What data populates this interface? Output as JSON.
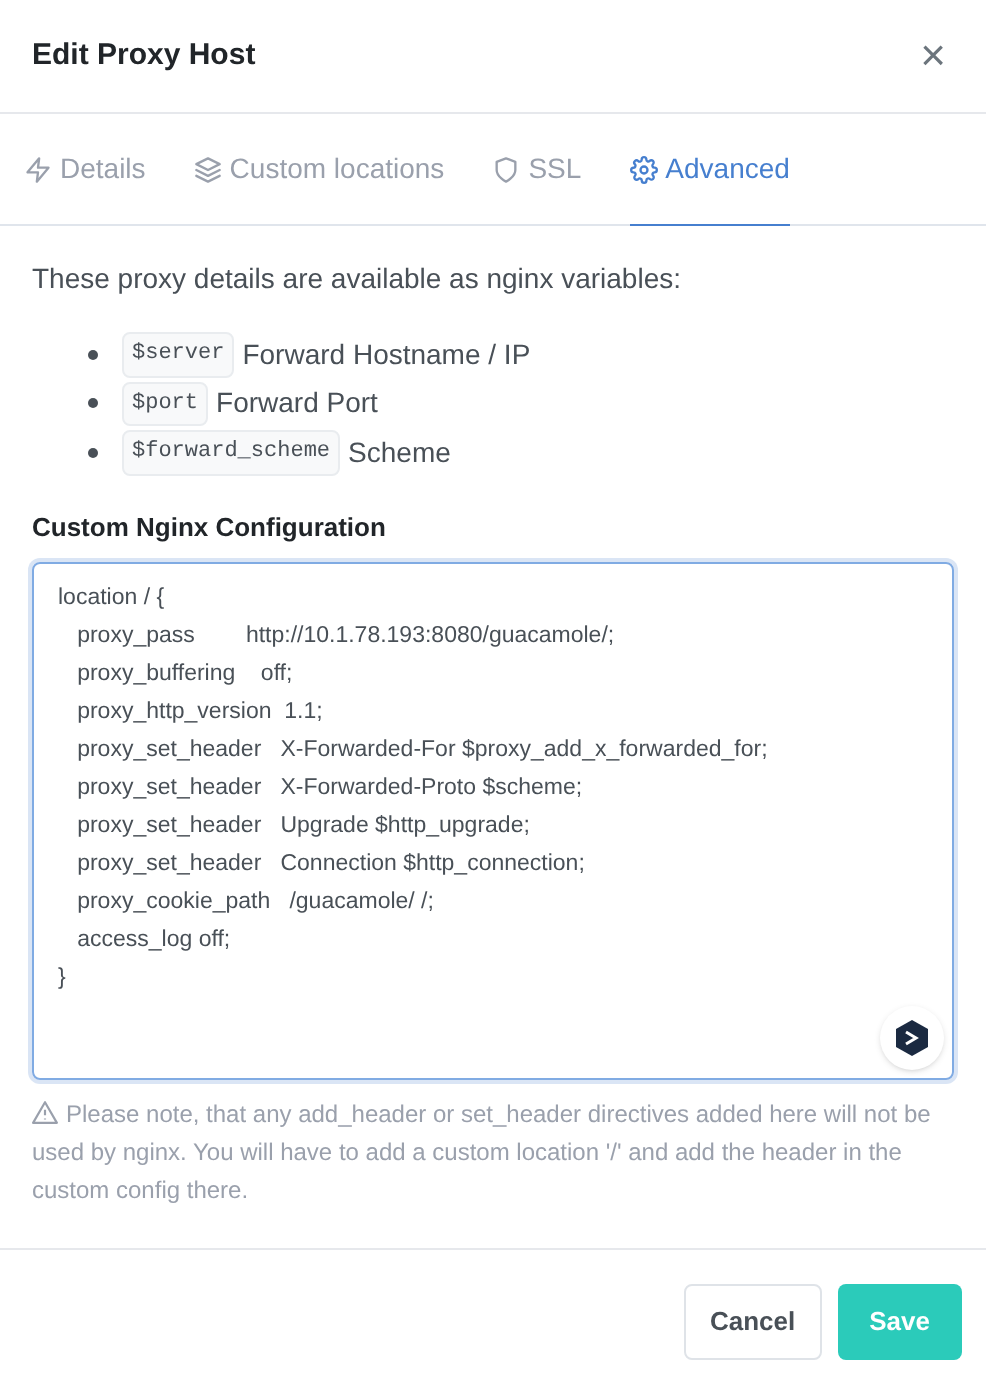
{
  "dialog": {
    "title": "Edit Proxy Host",
    "close": "×"
  },
  "tabs": [
    {
      "label": "Details",
      "kind": "bolt",
      "selected": false
    },
    {
      "label": "Custom locations",
      "kind": "layers",
      "selected": false
    },
    {
      "label": "SSL",
      "kind": "shield",
      "selected": false
    },
    {
      "label": "Advanced",
      "kind": "gear",
      "selected": true
    }
  ],
  "intro": "These proxy details are available as nginx variables:",
  "variables": [
    {
      "code": "$server",
      "text": "Forward Hostname / IP"
    },
    {
      "code": "$port",
      "text": "Forward Port"
    },
    {
      "code": "$forward_scheme",
      "text": "Scheme"
    }
  ],
  "config_label": "Custom Nginx Configuration",
  "config_lines": [
    "location / {",
    "   proxy_pass        http://10.1.78.193:8080/guacamole/;",
    "   proxy_buffering    off;",
    "   proxy_http_version  1.1;",
    "   proxy_set_header   X-Forwarded-For $proxy_add_x_forwarded_for;",
    "   proxy_set_header   X-Forwarded-Proto $scheme;",
    "   proxy_set_header   Upgrade $http_upgrade;",
    "   proxy_set_header   Connection $http_connection;",
    "   proxy_cookie_path   /guacamole/ /;",
    "   access_log off;",
    "}"
  ],
  "note": "Please note, that any add_header or set_header directives added here will not be used by nginx. You will have to add a custom location '/' and add the header in the custom config there.",
  "buttons": [
    {
      "label": "Cancel",
      "kind": "secondary"
    },
    {
      "label": "Save",
      "kind": "primary"
    }
  ]
}
